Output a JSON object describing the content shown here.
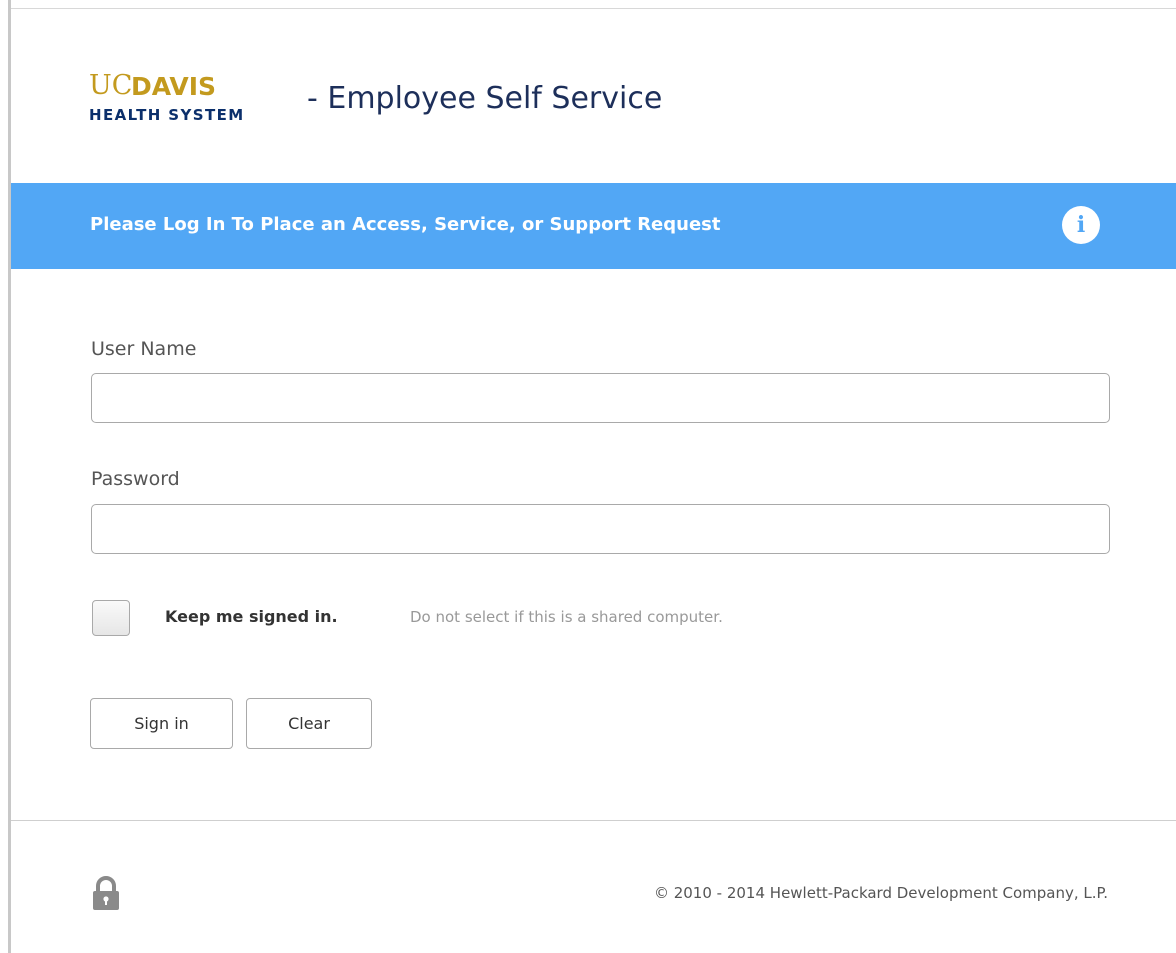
{
  "header": {
    "logo": {
      "uc": "UC",
      "davis": "DAVIS",
      "health_system": "HEALTH SYSTEM"
    },
    "title": "- Employee Self Service"
  },
  "banner": {
    "text": "Please Log In To Place an Access, Service, or Support Request",
    "icon": "info-icon",
    "color": "#52a7f5"
  },
  "form": {
    "username": {
      "label": "User Name",
      "value": ""
    },
    "password": {
      "label": "Password",
      "value": ""
    },
    "keep_signed_in": {
      "label": "Keep me signed in.",
      "hint": "Do not select if this is a shared computer.",
      "checked": false
    },
    "buttons": {
      "signin": "Sign in",
      "clear": "Clear"
    }
  },
  "footer": {
    "icon": "lock-icon",
    "copyright": "© 2010 - 2014 Hewlett-Packard Development Company, L.P."
  }
}
